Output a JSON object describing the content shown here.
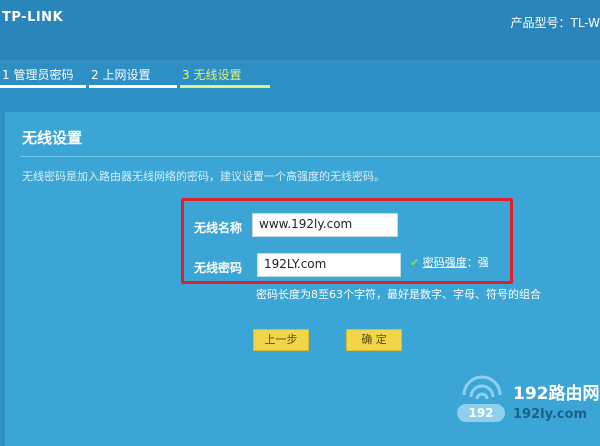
{
  "brand": {
    "logo_text": "TP-LINK",
    "model_label": "产品型号：TL-W"
  },
  "steps": [
    {
      "label": "1 管理员密码"
    },
    {
      "label": "2 上网设置"
    },
    {
      "label": "3 无线设置"
    }
  ],
  "panel": {
    "title": "无线设置",
    "description": "无线密码是加入路由器无线网络的密码，建议设置一个高强度的无线密码。"
  },
  "form": {
    "ssid_label": "无线名称",
    "ssid_value": "www.192ly.com",
    "password_label": "无线密码",
    "password_value": "192LY.com",
    "strength_check": "✔",
    "strength_link": "密码强度",
    "strength_value": "：强",
    "hint": "密码长度为8至63个字符，最好是数字、字母、符号的组合"
  },
  "buttons": {
    "prev": "上一步",
    "confirm": "确 定"
  },
  "watermark": {
    "big": "192路由网",
    "small": "192ly.com",
    "pill": "192"
  },
  "colors": {
    "accent": "#d9f580",
    "button": "#f2d64a",
    "highlight_box": "#e0202a"
  }
}
